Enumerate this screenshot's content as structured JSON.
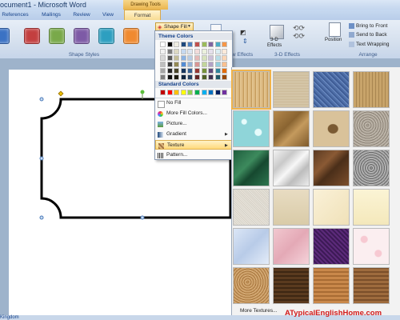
{
  "window": {
    "title": "ocument1 - Microsoft Word",
    "context_tab": "Drawing Tools"
  },
  "tabs": [
    {
      "label": "References"
    },
    {
      "label": "Mailings"
    },
    {
      "label": "Review"
    },
    {
      "label": "View"
    },
    {
      "label": "Format"
    }
  ],
  "ribbon": {
    "shape_styles_label": "Shape Styles",
    "shape_fill_label": "Shape Fill",
    "shadow_effects_label": "w Effects",
    "three_d": {
      "button": "3-D",
      "button2": "Effects",
      "group": "3-D Effects"
    },
    "arrange": {
      "bring_to_front": "Bring to Front",
      "send_to_back": "Send to Back",
      "text_wrapping": "Text Wrapping",
      "position": "Position",
      "group": "Arrange"
    },
    "style_colors": [
      "#3b72c4",
      "#c33f3f",
      "#79a94a",
      "#7d5aa6",
      "#2d9fc0",
      "#f08a2f"
    ]
  },
  "fill_menu": {
    "theme_colors_label": "Theme Colors",
    "standard_colors_label": "Standard Colors",
    "theme_colors": [
      [
        "#ffffff",
        "#000000",
        "#eeece1",
        "#1f497d",
        "#4f81bd",
        "#c0504d",
        "#9bbb59",
        "#8064a2",
        "#4bacc6",
        "#f79646"
      ],
      [
        "#f2f2f2",
        "#7f7f7f",
        "#ddd9c3",
        "#c6d9f0",
        "#dbe5f1",
        "#f2dcdb",
        "#ebf1dd",
        "#e5e0ec",
        "#dbeef3",
        "#fdeada"
      ],
      [
        "#d8d8d8",
        "#595959",
        "#c4bd97",
        "#8db3e2",
        "#b8cce4",
        "#e5b9b7",
        "#d7e3bc",
        "#ccc1d9",
        "#b7dde8",
        "#fbd5b5"
      ],
      [
        "#bfbfbf",
        "#3f3f3f",
        "#938953",
        "#548dd4",
        "#95b3d7",
        "#d99694",
        "#c3d69b",
        "#b2a2c7",
        "#92cddc",
        "#fac08f"
      ],
      [
        "#a5a5a5",
        "#262626",
        "#494429",
        "#17365d",
        "#366092",
        "#953734",
        "#76923c",
        "#5f497a",
        "#31859b",
        "#e36c09"
      ],
      [
        "#7f7f7f",
        "#0c0c0c",
        "#1d1b10",
        "#0f243e",
        "#244061",
        "#632423",
        "#4f6128",
        "#3f3151",
        "#205867",
        "#974806"
      ]
    ],
    "standard_colors": [
      "#c00000",
      "#ff0000",
      "#ffc000",
      "#ffff00",
      "#92d050",
      "#00b050",
      "#00b0f0",
      "#0070c0",
      "#002060",
      "#7030a0"
    ],
    "items": [
      {
        "label": "No Fill",
        "icon": "no-fill-icon"
      },
      {
        "label": "More Fill Colors...",
        "icon": "palette-icon"
      },
      {
        "label": "Picture...",
        "icon": "picture-icon"
      },
      {
        "label": "Gradient",
        "icon": "gradient-icon"
      },
      {
        "label": "Texture",
        "icon": "texture-icon"
      },
      {
        "label": "Pattern...",
        "icon": "pattern-icon"
      }
    ]
  },
  "textures": {
    "names": [
      "Papyrus",
      "Canvas",
      "Denim",
      "Woven mat",
      "Water droplets",
      "Paper bag",
      "Fish fossil",
      "Sand",
      "Green marble",
      "White marble",
      "Brown marble",
      "Granite",
      "Newsprint",
      "Recycled paper",
      "Parchment",
      "Stationery",
      "Blue tissue paper",
      "Pink tissue paper",
      "Purple mesh",
      "Bouquet",
      "Cork",
      "Walnut",
      "Oak",
      "Medium wood"
    ],
    "more_label": "More Textures..."
  },
  "status": {
    "text": "Kingdom"
  },
  "watermark": "ATypicalEnglishHome.com"
}
